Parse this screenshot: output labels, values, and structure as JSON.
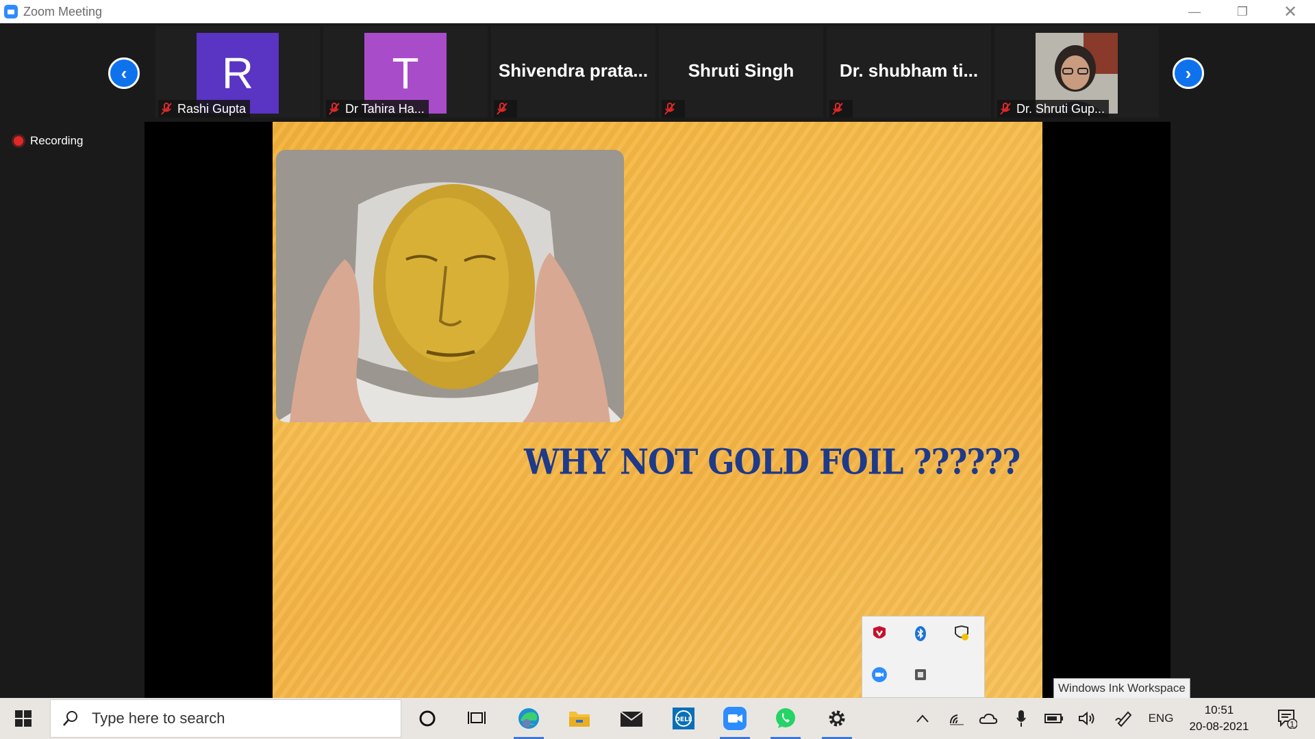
{
  "window": {
    "title": "Zoom Meeting"
  },
  "participants": [
    {
      "name": "Rashi Gupta",
      "initial": "R",
      "color": "#5a34c2",
      "type": "avatar"
    },
    {
      "name": "Dr Tahira Ha...",
      "initial": "T",
      "color": "#a94cc9",
      "type": "avatar"
    },
    {
      "name": "Shivendra  prata...",
      "type": "name-only"
    },
    {
      "name": "Shruti Singh",
      "type": "name-only"
    },
    {
      "name": "Dr. shubham  ti...",
      "type": "name-only"
    },
    {
      "name": "Dr. Shruti Gup...",
      "type": "photo"
    }
  ],
  "recording": {
    "label": "Recording"
  },
  "slide": {
    "headline": "WHY NOT GOLD FOIL  ??????"
  },
  "tooltip": {
    "text": "Windows Ink Workspace"
  },
  "taskbar": {
    "search_placeholder": "Type here to search",
    "language": "ENG",
    "time": "10:51",
    "date": "20-08-2021",
    "notification_count": "1"
  }
}
